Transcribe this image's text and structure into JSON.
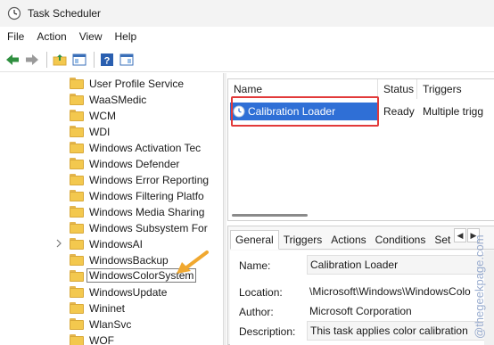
{
  "window": {
    "title": "Task Scheduler"
  },
  "menu": [
    "File",
    "Action",
    "View",
    "Help"
  ],
  "tree": {
    "items": [
      "User Profile Service",
      "WaaSMedic",
      "WCM",
      "WDI",
      "Windows Activation Tec",
      "Windows Defender",
      "Windows Error Reporting",
      "Windows Filtering Platfo",
      "Windows Media Sharing",
      "Windows Subsystem For",
      "WindowsAI",
      "WindowsBackup",
      "WindowsColorSystem",
      "WindowsUpdate",
      "Wininet",
      "WlanSvc",
      "WOF"
    ],
    "selected": "WindowsColorSystem"
  },
  "task_list": {
    "columns": {
      "name": "Name",
      "status": "Status",
      "triggers": "Triggers"
    },
    "rows": [
      {
        "name": "Calibration Loader",
        "status": "Ready",
        "triggers": "Multiple trigg"
      }
    ]
  },
  "details": {
    "tabs": [
      "General",
      "Triggers",
      "Actions",
      "Conditions",
      "Set"
    ],
    "active_tab": "General",
    "fields": {
      "name_label": "Name:",
      "name_value": "Calibration Loader",
      "location_label": "Location:",
      "location_value": "\\Microsoft\\Windows\\WindowsColo",
      "author_label": "Author:",
      "author_value": "Microsoft Corporation",
      "description_label": "Description:",
      "description_value": "This task applies color calibration"
    }
  },
  "watermark": "@thegeekpage.com",
  "colors": {
    "selection": "#2f6fd6",
    "highlight": "#e23a3a",
    "annotation_arrow": "#f0a830"
  }
}
